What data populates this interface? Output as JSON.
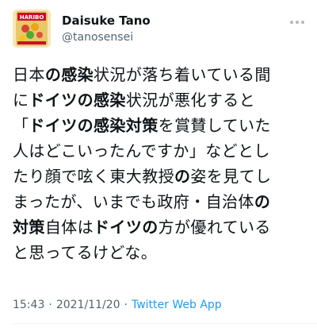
{
  "user": {
    "display_name": "Daisuke Tano",
    "handle": "@tanosensei",
    "avatar_text": "HARIBO",
    "avatar_icon": "candy-bag-avatar"
  },
  "more_icon": "more-dots-icon",
  "tweet": {
    "segments": [
      [
        {
          "t": "日本",
          "b": false
        },
        {
          "t": "の感染",
          "b": true
        },
        {
          "t": "状況が落ち着いている間",
          "b": false
        }
      ],
      [
        {
          "t": "に",
          "b": false
        },
        {
          "t": "ドイツの感染",
          "b": true
        },
        {
          "t": "状況が悪化すると",
          "b": false
        }
      ],
      [
        {
          "t": "「",
          "b": false
        },
        {
          "t": "ドイツの感染対策",
          "b": true
        },
        {
          "t": "を賞賛していた",
          "b": false
        }
      ],
      [
        {
          "t": "人はどこいったんですか」などとし",
          "b": false
        }
      ],
      [
        {
          "t": "たり顔で呟く東大教授",
          "b": false
        },
        {
          "t": "の",
          "b": true
        },
        {
          "t": "姿を見てし",
          "b": false
        }
      ],
      [
        {
          "t": "まったが、いまでも政府・自治体",
          "b": false
        },
        {
          "t": "の",
          "b": true
        }
      ],
      [
        {
          "t": "対策",
          "b": true
        },
        {
          "t": "自体は",
          "b": false
        },
        {
          "t": "ドイツの",
          "b": true
        },
        {
          "t": "方が優れている",
          "b": false
        }
      ],
      [
        {
          "t": "と思ってるけどな。",
          "b": false
        }
      ]
    ]
  },
  "meta": {
    "time": "15:43",
    "separator": "·",
    "date": "2021/11/20",
    "app": "Twitter Web App"
  },
  "colors": {
    "text": "#0f1419",
    "secondary": "#536471",
    "link": "#1d9bf0"
  }
}
